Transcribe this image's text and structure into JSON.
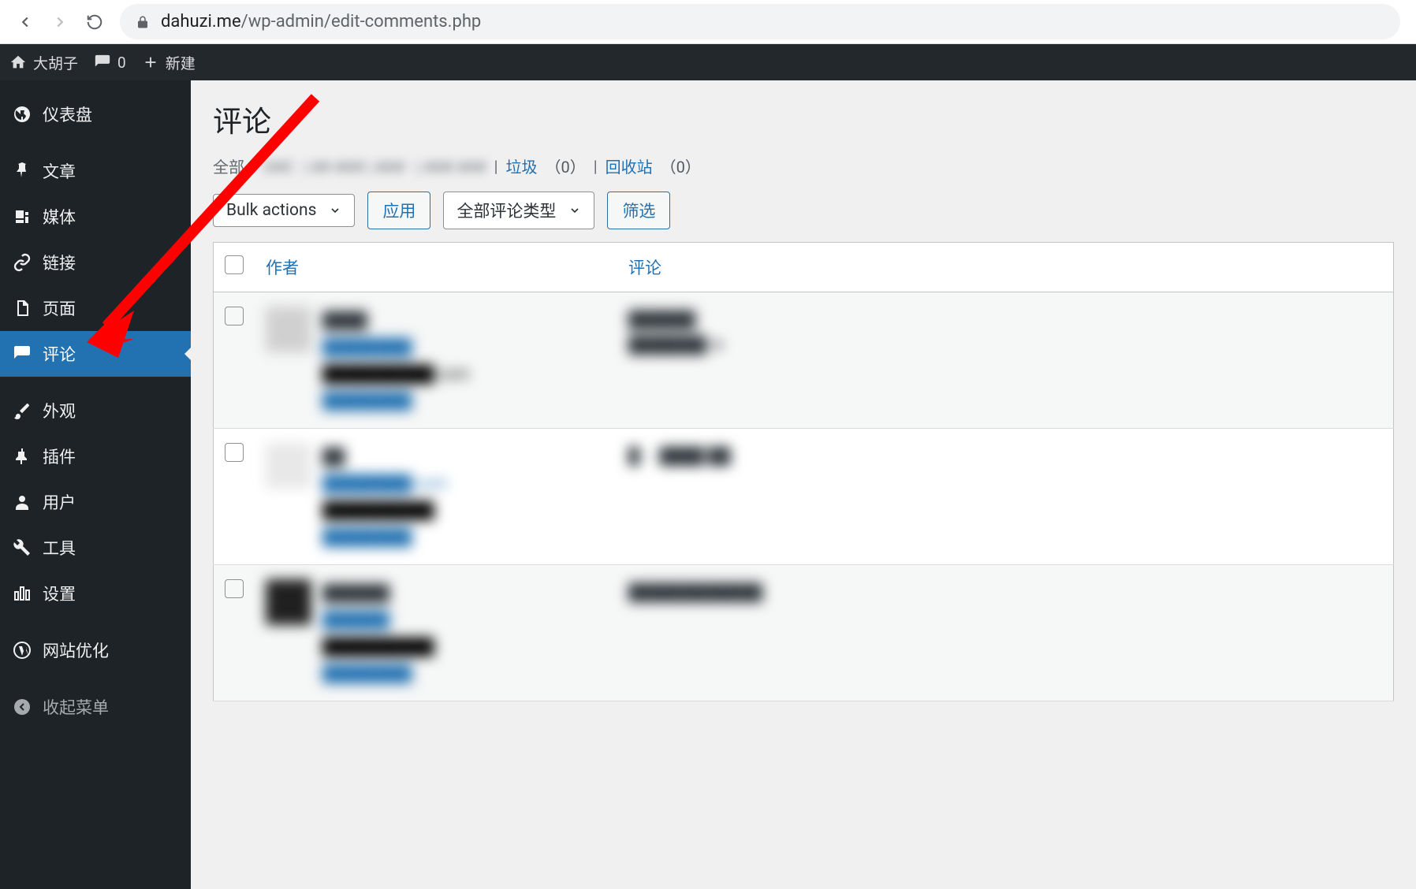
{
  "browser": {
    "url_domain": "dahuzi.me",
    "url_path": "/wp-admin/edit-comments.php"
  },
  "adminbar": {
    "site_name": "大胡子",
    "comments_count": "0",
    "new_label": "新建"
  },
  "sidebar": {
    "items": [
      {
        "icon": "dashboard",
        "label": "仪表盘"
      },
      {
        "icon": "pin",
        "label": "文章"
      },
      {
        "icon": "media",
        "label": "媒体"
      },
      {
        "icon": "link",
        "label": "链接"
      },
      {
        "icon": "page",
        "label": "页面"
      },
      {
        "icon": "comment",
        "label": "评论"
      },
      {
        "icon": "brush",
        "label": "外观"
      },
      {
        "icon": "plugin",
        "label": "插件"
      },
      {
        "icon": "user",
        "label": "用户"
      },
      {
        "icon": "tool",
        "label": "工具"
      },
      {
        "icon": "settings",
        "label": "设置"
      },
      {
        "icon": "wordpress",
        "label": "网站优化"
      },
      {
        "icon": "collapse",
        "label": "收起菜单"
      }
    ]
  },
  "page": {
    "title": "评论"
  },
  "filters": {
    "all_prefix": "全部",
    "spam_label": "垃圾",
    "spam_count": "（0）",
    "trash_label": "回收站",
    "trash_count": "（0）"
  },
  "actions": {
    "bulk_label": "Bulk actions",
    "apply_label": "应用",
    "type_label": "全部评论类型",
    "filter_label": "筛选"
  },
  "table": {
    "col_author": "作者",
    "col_comment": "评论"
  }
}
